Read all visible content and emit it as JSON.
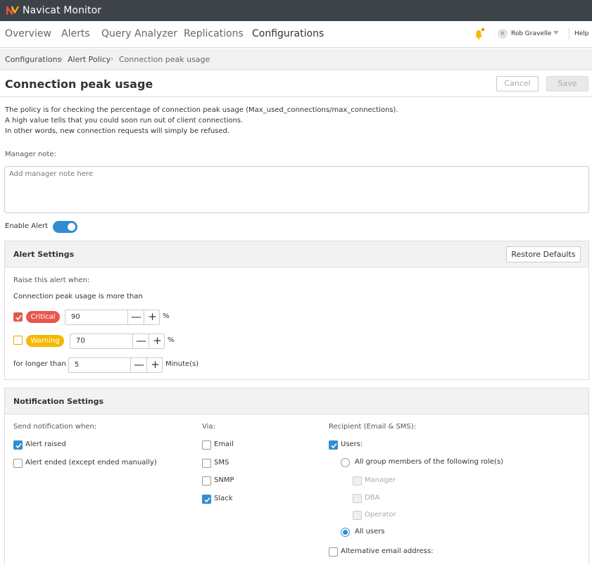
{
  "app": {
    "title": "Navicat Monitor"
  },
  "nav": {
    "tabs": [
      {
        "label": "Overview"
      },
      {
        "label": "Alerts"
      },
      {
        "label": "Query Analyzer"
      },
      {
        "label": "Replications"
      },
      {
        "label": "Configurations"
      }
    ],
    "user_initial": "R",
    "user_name": "Rob Gravelle",
    "help": "Help",
    "accent": "#2f8dd0"
  },
  "breadcrumb": {
    "items": [
      "Configurations",
      "Alert Policy",
      "Connection peak usage"
    ],
    "separator": "›"
  },
  "header": {
    "title": "Connection peak usage",
    "cancel": "Cancel",
    "save": "Save"
  },
  "description": {
    "lines": [
      "The policy is for checking the percentage of connection peak usage (Max_used_connections/max_connections).",
      "A high value tells that you could soon run out of client connections.",
      "In other words, new connection requests will simply be refused."
    ]
  },
  "manager_note": {
    "label": "Manager note:",
    "placeholder": "Add manager note here",
    "value": ""
  },
  "enable_alert": {
    "label": "Enable Alert",
    "enabled": true
  },
  "alert_settings": {
    "title": "Alert Settings",
    "restore": "Restore Defaults",
    "raise_when": "Raise this alert when:",
    "condition": "Connection peak usage is more than",
    "critical": {
      "label": "Critical",
      "checked": true,
      "value": "90",
      "unit": "%",
      "color": "#e8574a"
    },
    "warning": {
      "label": "Warning",
      "checked": false,
      "value": "70",
      "unit": "%",
      "color": "#f5b800"
    },
    "duration": {
      "label": "for longer than",
      "value": "5",
      "unit": "Minute(s)"
    },
    "minus": "—",
    "plus": "+"
  },
  "notification_settings": {
    "title": "Notification Settings",
    "send_when": {
      "heading": "Send notification when:",
      "options": [
        {
          "label": "Alert raised",
          "checked": true
        },
        {
          "label": "Alert ended (except ended manually)",
          "checked": false
        }
      ]
    },
    "via": {
      "heading": "Via:",
      "options": [
        {
          "label": "Email",
          "checked": false
        },
        {
          "label": "SMS",
          "checked": false
        },
        {
          "label": "SNMP",
          "checked": false
        },
        {
          "label": "Slack",
          "checked": true
        }
      ]
    },
    "recipient": {
      "heading": "Recipient (Email & SMS):",
      "users": {
        "label": "Users:",
        "checked": true
      },
      "group_option": "All group members of the following role(s)",
      "roles": [
        "Manager",
        "DBA",
        "Operator"
      ],
      "all_users": "All users",
      "alt_email": {
        "label": "Alternative email address:",
        "checked": false
      }
    }
  }
}
